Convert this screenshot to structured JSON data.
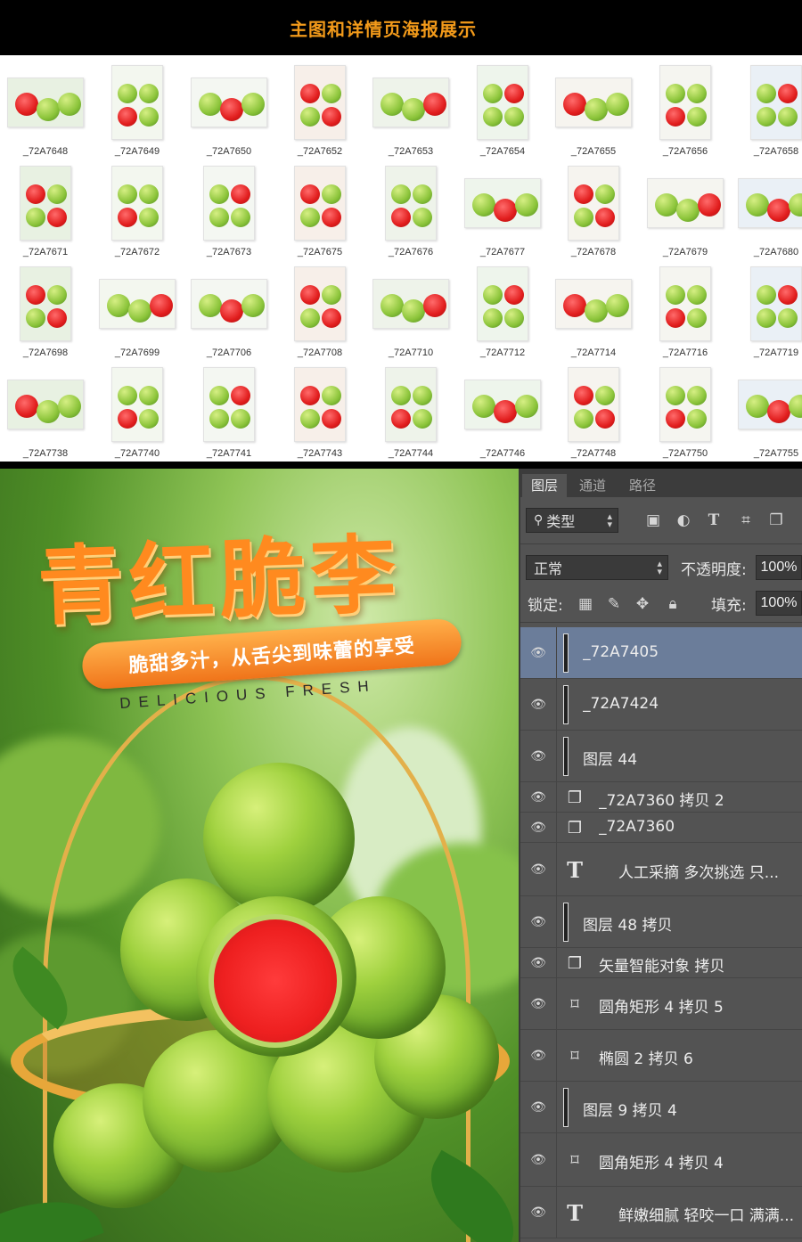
{
  "header": {
    "title": "主图和详情页海报展示"
  },
  "thumbnails": [
    {
      "label": "_72A7648"
    },
    {
      "label": "_72A7649"
    },
    {
      "label": "_72A7650"
    },
    {
      "label": "_72A7652"
    },
    {
      "label": "_72A7653"
    },
    {
      "label": "_72A7654"
    },
    {
      "label": "_72A7655"
    },
    {
      "label": "_72A7656"
    },
    {
      "label": "_72A7658"
    },
    {
      "label": "_72A7671"
    },
    {
      "label": "_72A7672"
    },
    {
      "label": "_72A7673"
    },
    {
      "label": "_72A7675"
    },
    {
      "label": "_72A7676"
    },
    {
      "label": "_72A7677"
    },
    {
      "label": "_72A7678"
    },
    {
      "label": "_72A7679"
    },
    {
      "label": "_72A7680"
    },
    {
      "label": "_72A7698"
    },
    {
      "label": "_72A7699"
    },
    {
      "label": "_72A7706"
    },
    {
      "label": "_72A7708"
    },
    {
      "label": "_72A7710"
    },
    {
      "label": "_72A7712"
    },
    {
      "label": "_72A7714"
    },
    {
      "label": "_72A7716"
    },
    {
      "label": "_72A7719"
    },
    {
      "label": "_72A7738"
    },
    {
      "label": "_72A7740"
    },
    {
      "label": "_72A7741"
    },
    {
      "label": "_72A7743"
    },
    {
      "label": "_72A7744"
    },
    {
      "label": "_72A7746"
    },
    {
      "label": "_72A7748"
    },
    {
      "label": "_72A7750"
    },
    {
      "label": "_72A7755"
    }
  ],
  "poster": {
    "title": "青红脆李",
    "slogan": "脆甜多汁，从舌尖到味蕾的享受",
    "english": "DELICIOUS FRESH"
  },
  "panel": {
    "tabs": [
      "图层",
      "通道",
      "路径"
    ],
    "filter_label": "类型",
    "blend_mode": "正常",
    "opacity_label": "不透明度:",
    "opacity_value": "100%",
    "lock_label": "锁定:",
    "fill_label": "填充:",
    "fill_value": "100%",
    "layers": [
      {
        "name": "_72A7405",
        "icon": "pixel-layer",
        "selected": true
      },
      {
        "name": "_72A7424",
        "icon": "pixel-layer"
      },
      {
        "name": "图层 44",
        "icon": "pixel-layer"
      },
      {
        "name": "_72A7360 拷贝 2",
        "icon": "smart-object"
      },
      {
        "name": "_72A7360",
        "icon": "smart-object"
      },
      {
        "name": "人工采摘 多次挑选 只...",
        "icon": "text-layer"
      },
      {
        "name": "图层 48 拷贝",
        "icon": "pixel-layer"
      },
      {
        "name": "矢量智能对象 拷贝",
        "icon": "smart-object"
      },
      {
        "name": "圆角矩形 4 拷贝 5",
        "icon": "shape-layer"
      },
      {
        "name": "椭圆 2 拷贝 6",
        "icon": "shape-layer"
      },
      {
        "name": "图层 9 拷贝 4",
        "icon": "pixel-layer"
      },
      {
        "name": "圆角矩形 4 拷贝 4",
        "icon": "shape-layer"
      },
      {
        "name": "鲜嫩细腻 轻咬一口 满满...",
        "icon": "text-layer"
      }
    ]
  }
}
